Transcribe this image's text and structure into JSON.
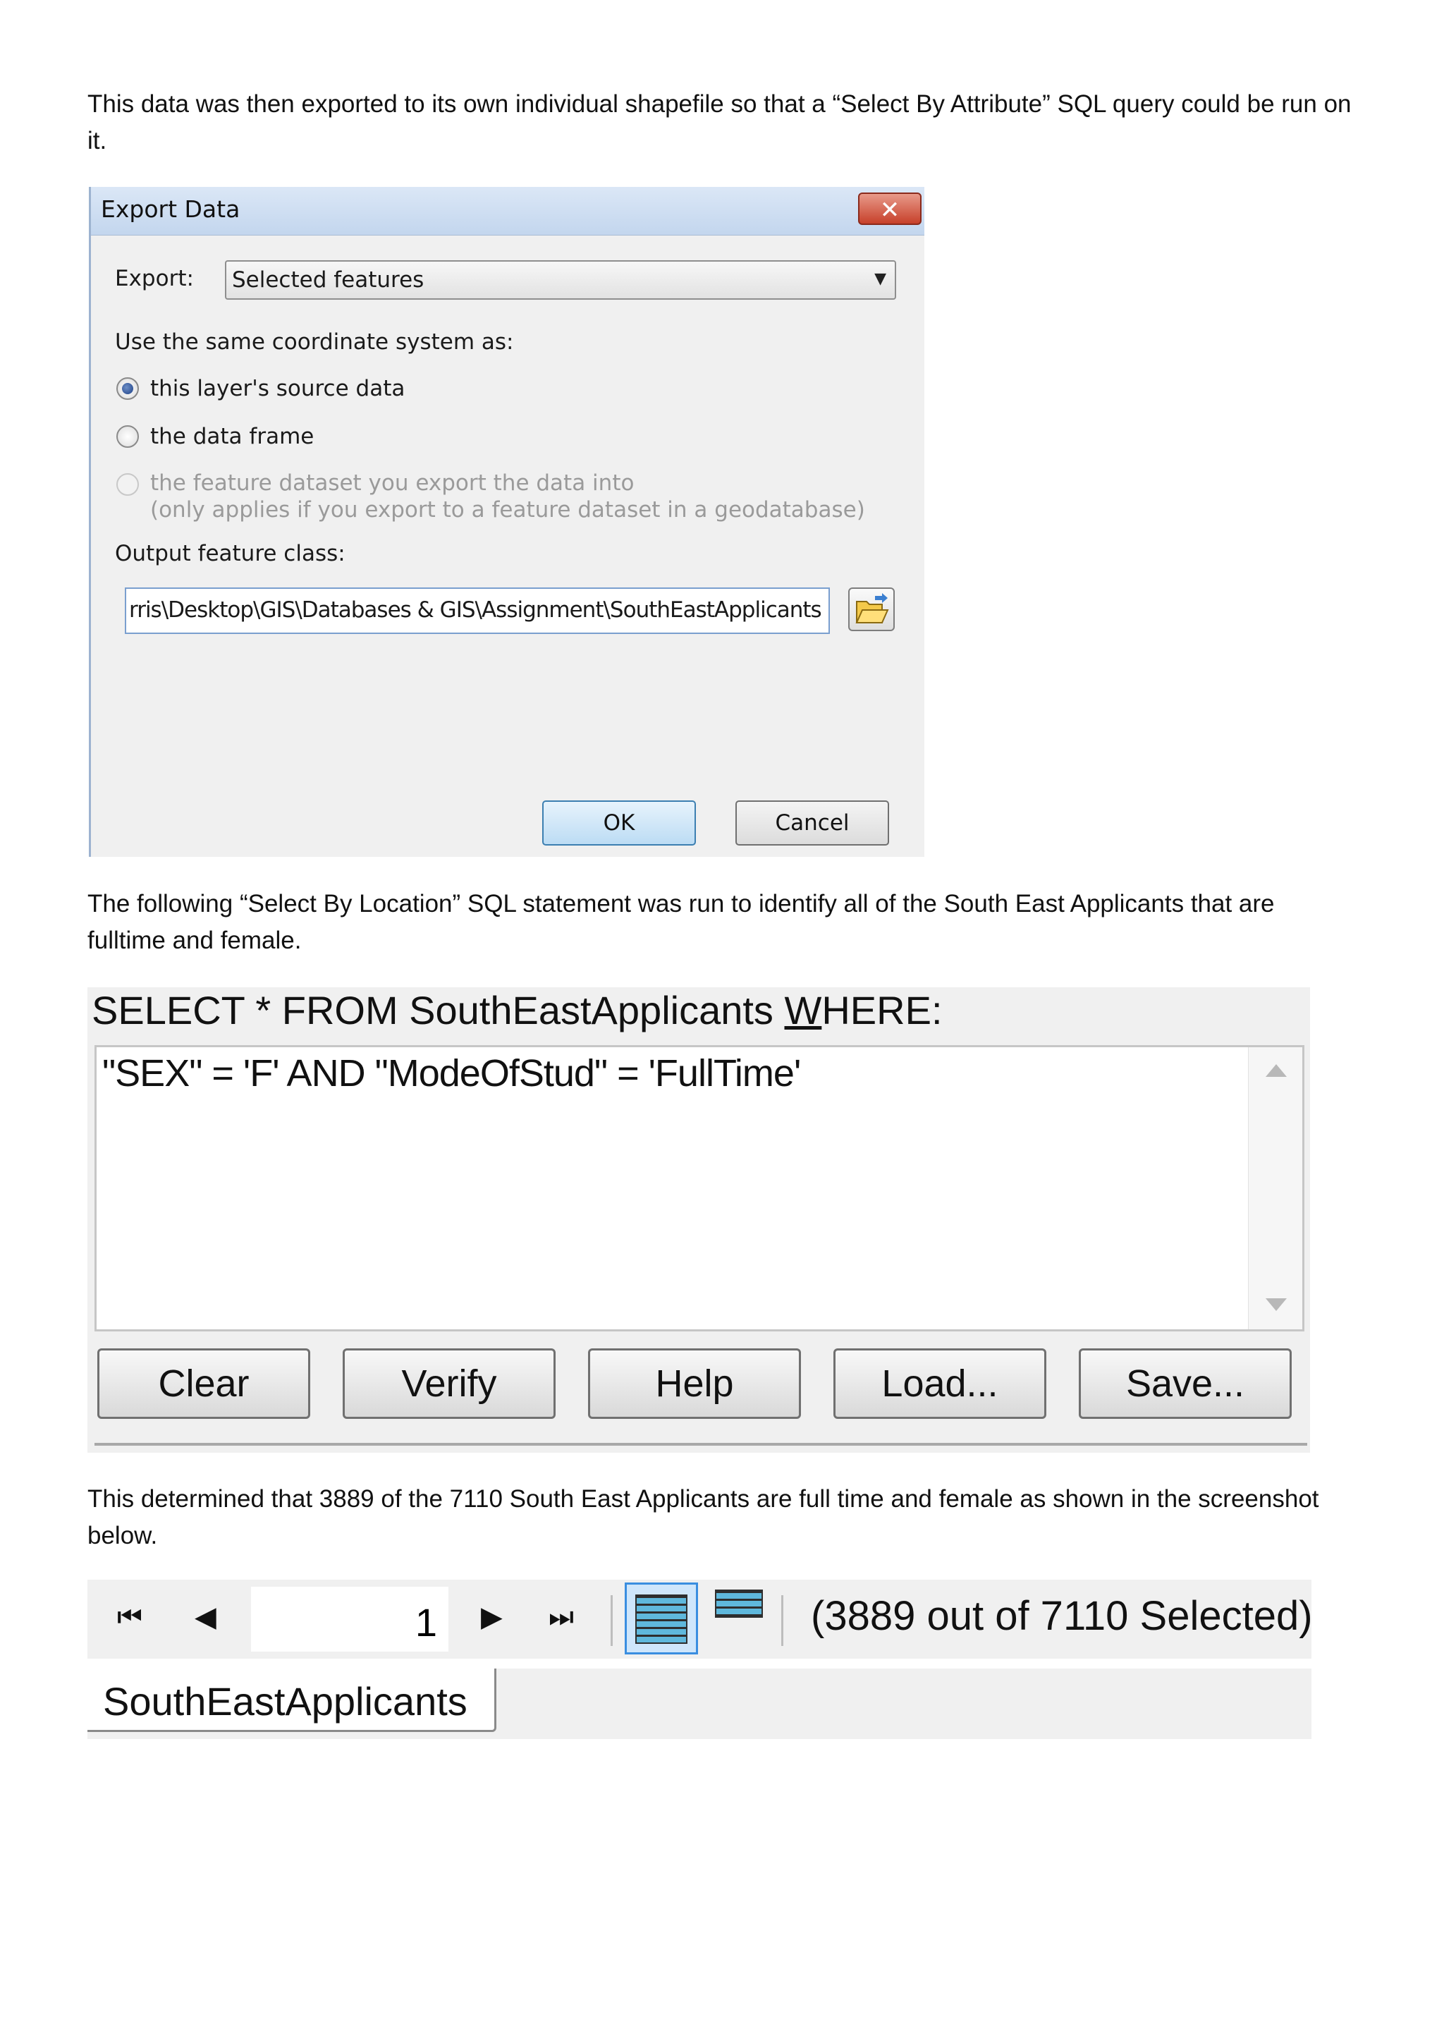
{
  "paragraphs": {
    "p1": "This data was then exported to its own individual shapefile so that a “Select By Attribute” SQL query could be run on it.",
    "p2": "The following “Select By Location” SQL statement was run to identify all of the South East Applicants that are fulltime and female.",
    "p3": "This determined that 3889 of the 7110 South East Applicants are full time and female as shown in the screenshot below."
  },
  "export_dialog": {
    "title": "Export Data",
    "close_glyph": "✕",
    "export_label": "Export:",
    "export_value": "Selected features",
    "dropdown_glyph": "▼",
    "coord_label": "Use the same coordinate system as:",
    "options": [
      {
        "label": "this layer's source data",
        "checked": true,
        "enabled": true
      },
      {
        "label": "the data frame",
        "checked": false,
        "enabled": true
      },
      {
        "label": "the feature dataset you export the data into",
        "sublabel": "(only applies if you export to a feature dataset in a geodatabase)",
        "checked": false,
        "enabled": false
      }
    ],
    "output_label": "Output feature class:",
    "output_value": "rris\\Desktop\\GIS\\Databases & GIS\\Assignment\\SouthEastApplicants",
    "ok_label": "OK",
    "cancel_label": "Cancel"
  },
  "sql_panel": {
    "header_prefix": "SELECT * FROM SouthEastApplicants ",
    "header_underlined": "W",
    "header_suffix": "HERE:",
    "expression": "\"SEX\" = 'F' AND \"ModeOfStud\" = 'FullTime'",
    "buttons": [
      "Clear",
      "Verify",
      "Help",
      "Load...",
      "Save..."
    ]
  },
  "table_toolbar": {
    "first_icon": "⏮",
    "prev_icon": "◀",
    "record_number": "1",
    "next_icon": "▶",
    "last_icon": "⏭",
    "selection_text": "(3889 out of 7110 Selected)",
    "tab_label": "SouthEastApplicants"
  },
  "colors": {
    "accent_blue": "#3a8ee0",
    "close_red": "#c7402a",
    "panel_gray": "#f0f0f0"
  }
}
